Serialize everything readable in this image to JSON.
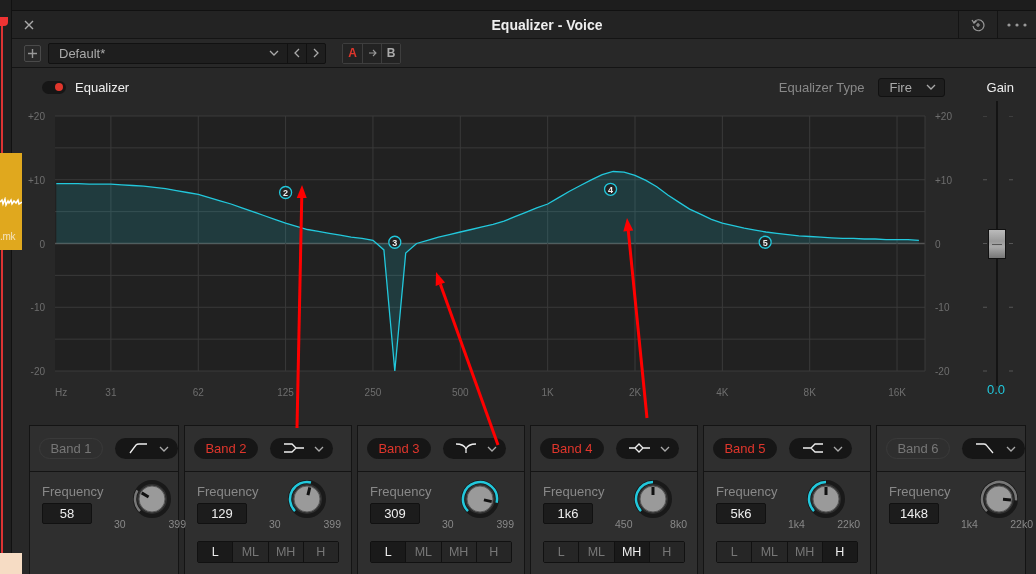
{
  "timeline": {
    "clip_label": ".mk"
  },
  "window": {
    "title": "Equalizer - Voice"
  },
  "preset": {
    "value": "Default*"
  },
  "compare": {
    "a": {
      "label": "A",
      "selected": true
    },
    "b": {
      "label": "B",
      "selected": false
    }
  },
  "equalizer": {
    "label": "Equalizer",
    "on": true
  },
  "equalizer_type": {
    "label": "Equalizer Type",
    "value": "Fire"
  },
  "gain": {
    "label": "Gain",
    "level": 0.5,
    "reading": "0.0"
  },
  "chart": {
    "chart_data": {
      "type": "area",
      "xlabel": "Hz",
      "categories": [
        null,
        null,
        null,
        null,
        null,
        "31",
        null,
        null,
        null,
        null,
        null,
        null,
        null,
        "62",
        null,
        null,
        null,
        null,
        null,
        null,
        null,
        "125",
        null,
        null,
        null,
        null,
        null,
        null,
        null,
        "250",
        null,
        null,
        null,
        null,
        null,
        null,
        null,
        "500",
        null,
        null,
        null,
        null,
        null,
        null,
        null,
        "1K",
        null,
        null,
        null,
        null,
        null,
        null,
        null,
        "2K",
        null,
        null,
        null,
        null,
        null,
        null,
        null,
        "4K",
        null,
        null,
        null,
        null,
        null,
        null,
        null,
        "8K",
        null,
        null,
        null,
        null,
        null,
        null,
        null,
        "16K",
        null,
        null
      ],
      "series": [
        {
          "color": "#22c8dc",
          "values": [
            9.4,
            9.4,
            9.4,
            9.3,
            9.3,
            9.3,
            9.2,
            9.1,
            9.0,
            8.8,
            8.6,
            8.3,
            8.0,
            7.7,
            7.2,
            6.7,
            6.2,
            5.6,
            5.0,
            4.4,
            3.8,
            3.2,
            2.7,
            2.2,
            1.9,
            1.6,
            1.3,
            1.0,
            0.8,
            0.5,
            -1,
            -20,
            -1.5,
            0,
            0.5,
            1.0,
            1.4,
            1.8,
            2.2,
            2.6,
            3.0,
            3.5,
            4.2,
            4.9,
            5.6,
            6.2,
            7.2,
            8.2,
            9.1,
            10.0,
            10.8,
            11.3,
            11.2,
            10.7,
            9.9,
            8.9,
            7.6,
            6.5,
            5.4,
            4.6,
            3.8,
            3.2,
            2.8,
            2.4,
            2.1,
            1.8,
            1.6,
            1.4,
            1.2,
            1.1,
            1.0,
            0.9,
            0.8,
            0.8,
            0.7,
            0.7,
            0.6,
            0.6,
            0.6,
            0.5
          ]
        }
      ],
      "ylim": [
        -20,
        20
      ],
      "y2lim": [
        -20,
        20
      ],
      "grid": true,
      "yticks": [
        {
          "value": 20,
          "label": "+20"
        },
        {
          "value": 10,
          "label": "+10"
        },
        0,
        -10,
        -20
      ],
      "y2ticks": [
        {
          "value": 20,
          "label": "+20"
        },
        {
          "value": 10,
          "label": "+10"
        },
        0,
        -10,
        -20
      ],
      "annotations": [
        "2",
        "3",
        "4",
        "5"
      ]
    }
  },
  "bands": [
    {
      "label": "Band 1",
      "active": false,
      "kind": "low_cut",
      "frequency_label": "Frequency",
      "frequency": "58",
      "level": 0.28,
      "min": "30",
      "max": "399"
    },
    {
      "label": "Band 2",
      "active": true,
      "kind": "high_shelf",
      "frequency_label": "Frequency",
      "frequency": "129",
      "level": 0.55,
      "min": "30",
      "max": "399",
      "ranges": [
        {
          "label": "L",
          "selected": true
        },
        {
          "label": "ML",
          "selected": false
        },
        {
          "label": "MH",
          "selected": false
        },
        {
          "label": "H",
          "selected": false
        }
      ]
    },
    {
      "label": "Band 3",
      "active": true,
      "kind": "notch",
      "frequency_label": "Frequency",
      "frequency": "309",
      "level": 0.88,
      "min": "30",
      "max": "399",
      "ranges": [
        {
          "label": "L",
          "selected": true
        },
        {
          "label": "ML",
          "selected": false
        },
        {
          "label": "MH",
          "selected": false
        },
        {
          "label": "H",
          "selected": false
        }
      ]
    },
    {
      "label": "Band 4",
      "active": true,
      "kind": "bell",
      "frequency_label": "Frequency",
      "frequency": "1k6",
      "level": 0.5,
      "min": "450",
      "max": "8k0",
      "ranges": [
        {
          "label": "L",
          "selected": false
        },
        {
          "label": "ML",
          "selected": false
        },
        {
          "label": "MH",
          "selected": true
        },
        {
          "label": "H",
          "selected": false
        }
      ]
    },
    {
      "label": "Band 5",
      "active": true,
      "kind": "low_shelf",
      "frequency_label": "Frequency",
      "frequency": "5k6",
      "level": 0.5,
      "min": "1k4",
      "max": "22k0",
      "ranges": [
        {
          "label": "L",
          "selected": false
        },
        {
          "label": "ML",
          "selected": false
        },
        {
          "label": "MH",
          "selected": false
        },
        {
          "label": "H",
          "selected": true
        }
      ]
    },
    {
      "label": "Band 6",
      "active": false,
      "kind": "high_cut",
      "frequency_label": "Frequency",
      "frequency": "14k8",
      "level": 0.85,
      "min": "1k4",
      "max": "22k0"
    }
  ]
}
